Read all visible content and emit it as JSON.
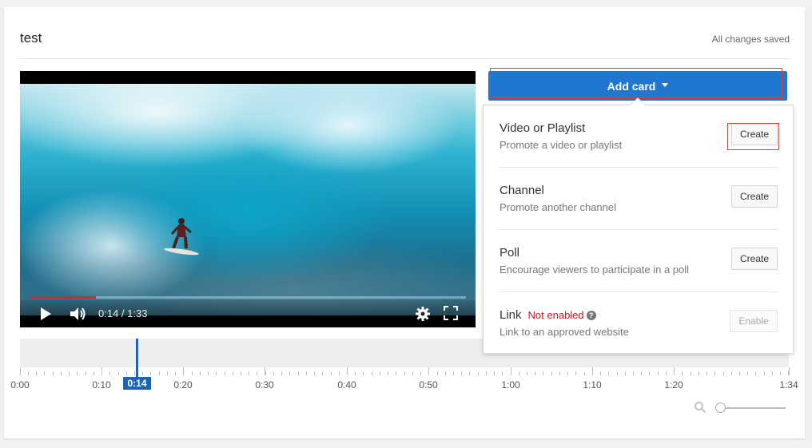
{
  "header": {
    "title": "test",
    "save_status": "All changes saved"
  },
  "player": {
    "progress_fraction": 0.152,
    "time_display": "0:14 / 1:33",
    "controls": {
      "play_icon": "play-icon",
      "volume_icon": "volume-icon",
      "settings_icon": "gear-icon",
      "fullscreen_icon": "fullscreen-icon"
    },
    "colors": {
      "progress": "#e52222"
    }
  },
  "timeline": {
    "playhead_label": "0:14",
    "tick_labels": [
      "0:00",
      "0:10",
      "0:20",
      "0:30",
      "0:40",
      "0:50",
      "1:00",
      "1:10",
      "1:20",
      "1:34"
    ],
    "zoom_icon": "search-icon",
    "colors": {
      "playhead": "#1f63b5"
    }
  },
  "cards": {
    "add_card_label": "Add card",
    "colors": {
      "button": "#1f77d0",
      "highlight": "#d8403a"
    },
    "options": [
      {
        "title": "Video or Playlist",
        "description": "Promote a video or playlist",
        "action": "Create"
      },
      {
        "title": "Channel",
        "description": "Promote another channel",
        "action": "Create"
      },
      {
        "title": "Poll",
        "description": "Encourage viewers to participate in a poll",
        "action": "Create"
      },
      {
        "title": "Link",
        "status": "Not enabled",
        "description": "Link to an approved website",
        "action": "Enable"
      }
    ]
  }
}
